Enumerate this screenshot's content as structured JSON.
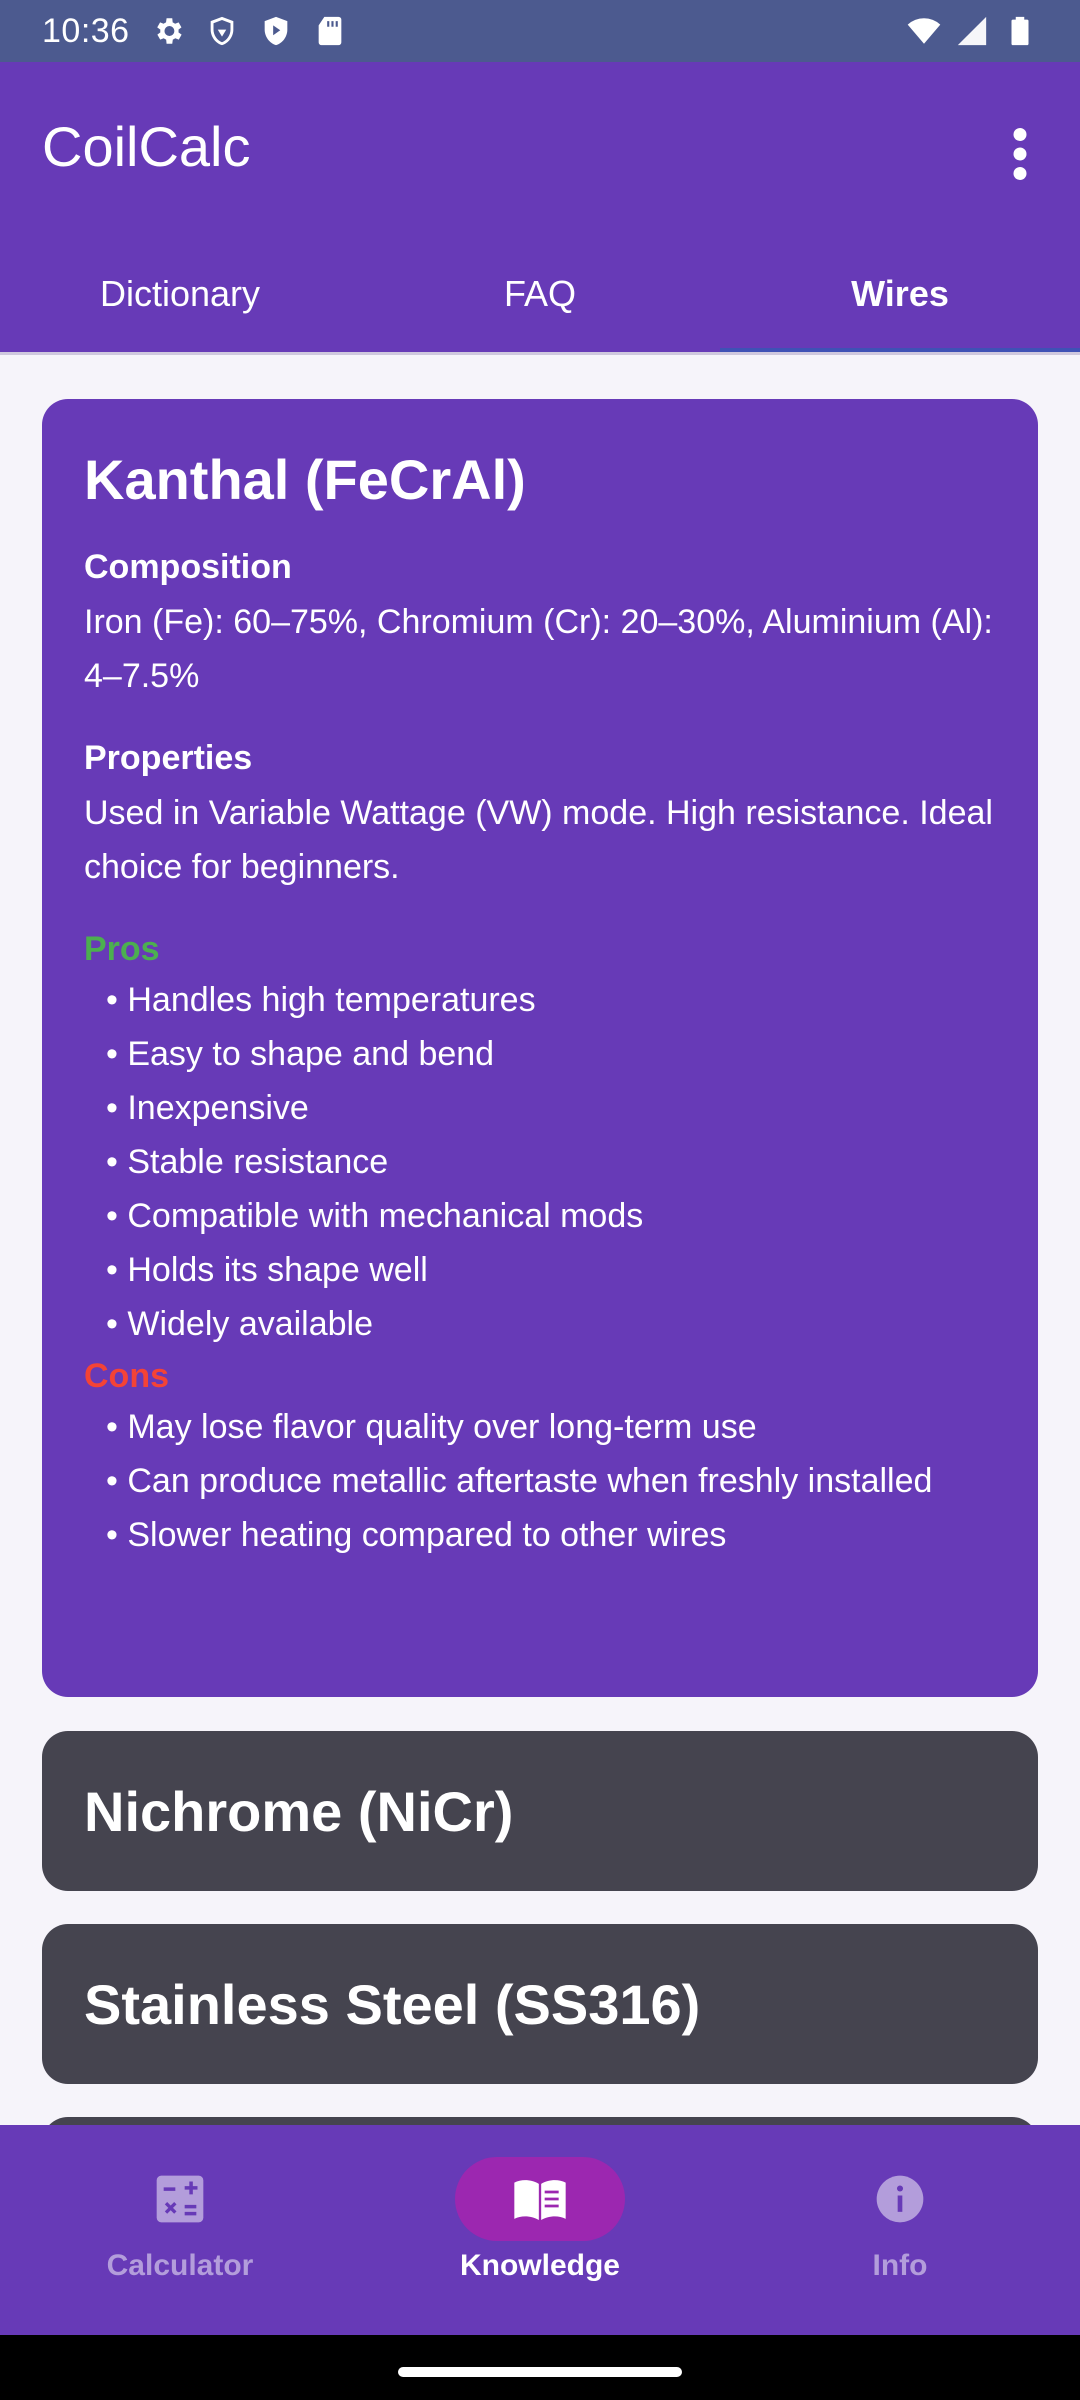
{
  "status_bar": {
    "time": "10:36",
    "left_icons": [
      "gear-icon",
      "shield-icon",
      "play-shield-icon",
      "sd-card-icon"
    ],
    "right_icons": [
      "wifi-icon",
      "signal-icon",
      "battery-icon"
    ]
  },
  "app_bar": {
    "title": "CoilCalc"
  },
  "tabs": [
    {
      "label": "Dictionary",
      "active": false
    },
    {
      "label": "FAQ",
      "active": false
    },
    {
      "label": "Wires",
      "active": true
    }
  ],
  "wires": {
    "expanded": {
      "title": "Kanthal (FeCrAl)",
      "composition_label": "Composition",
      "composition_text": "Iron (Fe): 60–75%, Chromium (Cr): 20–30%, Aluminium (Al): 4–7.5%",
      "properties_label": "Properties",
      "properties_text": "Used in Variable Wattage (VW) mode. High resistance. Ideal choice for beginners.",
      "pros_label": "Pros",
      "pros": [
        "• Handles high temperatures",
        "• Easy to shape and bend",
        "• Inexpensive",
        "• Stable resistance",
        "• Compatible with mechanical mods",
        "• Holds its shape well",
        "• Widely available"
      ],
      "cons_label": "Cons",
      "cons": [
        "• May lose flavor quality over long-term use",
        "• Can produce metallic aftertaste when freshly installed",
        "• Slower heating compared to other wires"
      ]
    },
    "collapsed": [
      {
        "title": "Nichrome (NiCr)"
      },
      {
        "title": "Stainless Steel (SS316)"
      }
    ]
  },
  "bottom_nav": [
    {
      "label": "Calculator",
      "icon": "calculator-icon",
      "active": false
    },
    {
      "label": "Knowledge",
      "icon": "book-icon",
      "active": true
    },
    {
      "label": "Info",
      "icon": "info-icon",
      "active": false
    }
  ],
  "colors": {
    "primary": "#673AB7",
    "pros": "#4CAF50",
    "cons": "#F44336",
    "collapsed_card": "#45444F",
    "active_pill": "#9C27B0"
  }
}
